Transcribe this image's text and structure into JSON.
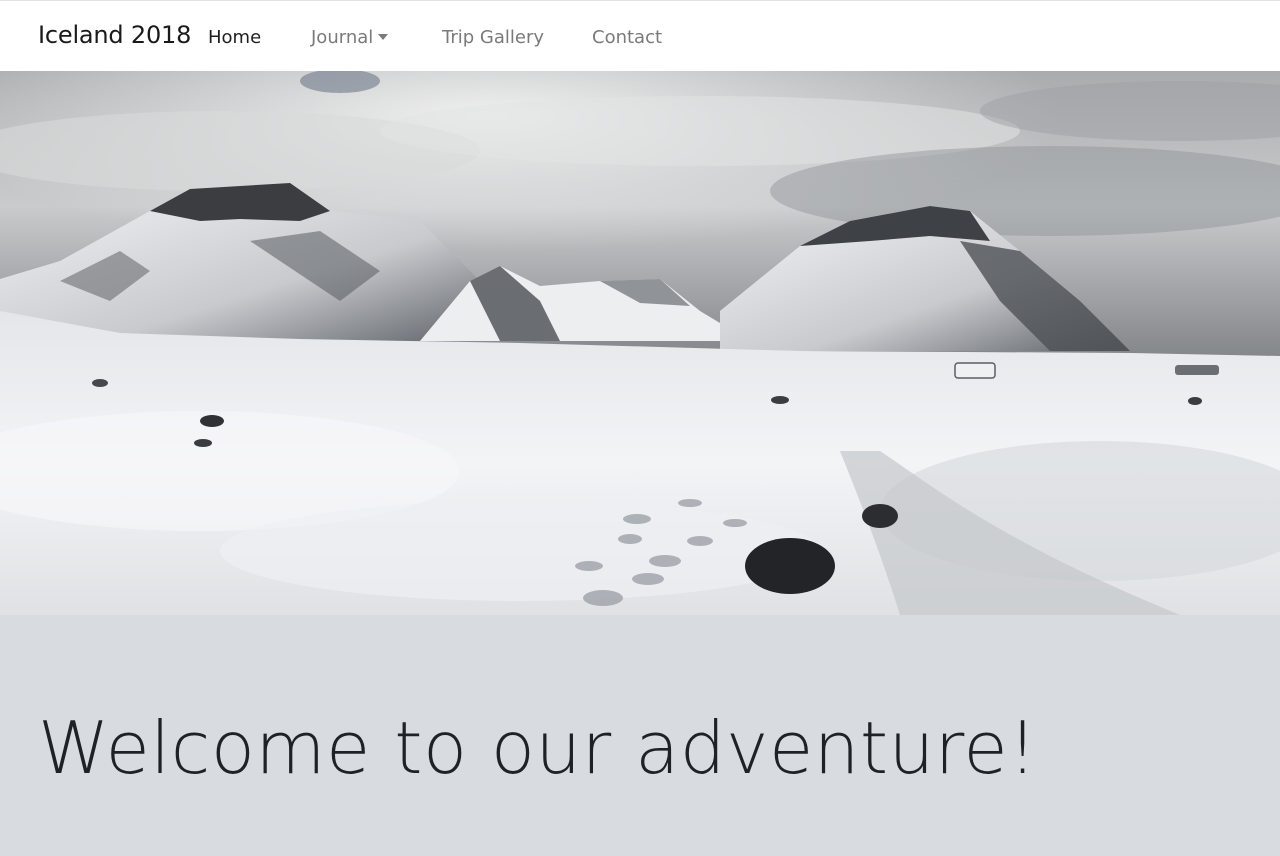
{
  "navbar": {
    "brand": "Iceland 2018",
    "links": [
      {
        "label": "Home",
        "active": true
      },
      {
        "label": "Journal",
        "dropdown": true
      },
      {
        "label": "Trip Gallery"
      },
      {
        "label": "Contact"
      }
    ]
  },
  "hero": {
    "description": "photo of snowy mountain landscape"
  },
  "jumbotron": {
    "headline": "Welcome to our adventure!"
  }
}
